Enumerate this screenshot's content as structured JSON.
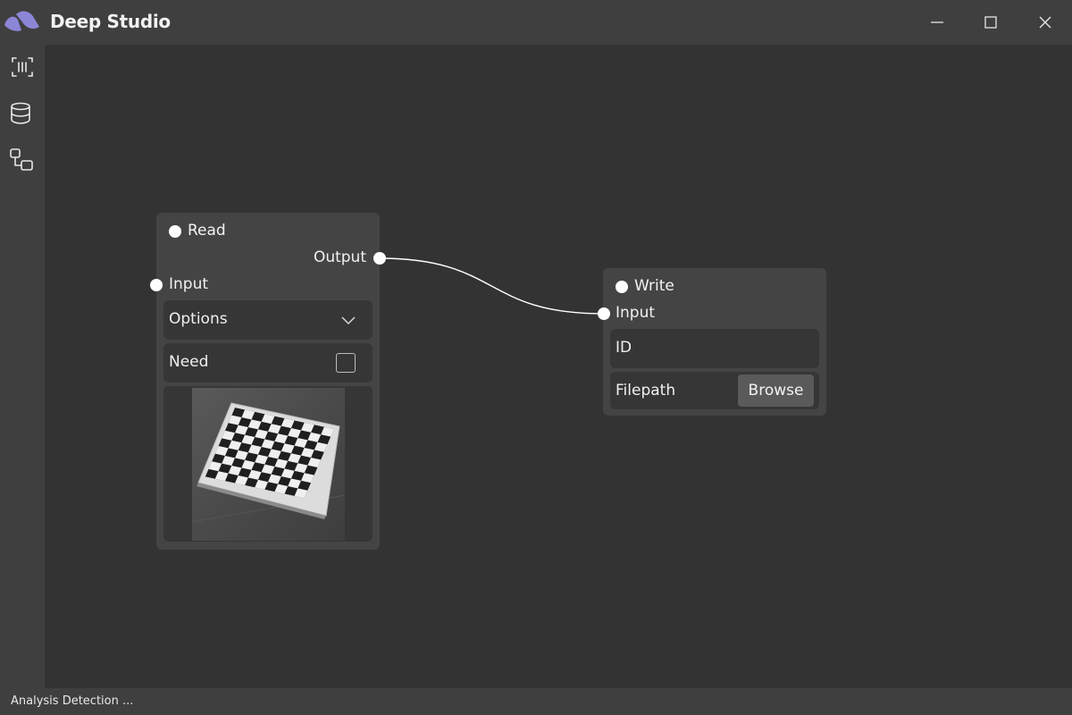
{
  "app": {
    "title": "Deep Studio",
    "accent_color": "#8b86d6"
  },
  "window_controls": [
    "minimize-icon",
    "maximize-icon",
    "close-icon"
  ],
  "sidebar": {
    "items": [
      {
        "name": "scan-icon"
      },
      {
        "name": "database-icon"
      },
      {
        "name": "flow-icon"
      }
    ]
  },
  "nodes": {
    "read": {
      "title": "Read",
      "output_label": "Output",
      "input_label": "Input",
      "options_label": "Options",
      "need_label": "Need",
      "need_checked": false,
      "preview_icon": "checkerboard-image"
    },
    "write": {
      "title": "Write",
      "input_label": "Input",
      "id_label": "ID",
      "filepath_label": "Filepath",
      "browse_label": "Browse"
    }
  },
  "connections": [
    {
      "from": "read.output",
      "to": "write.input"
    }
  ],
  "status": {
    "text": "Analysis Detection ..."
  }
}
